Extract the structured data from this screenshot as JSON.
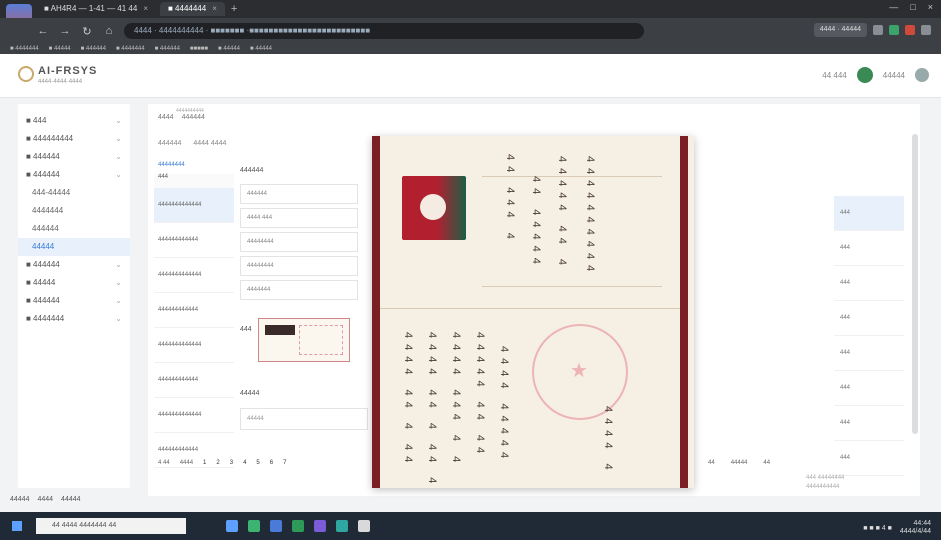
{
  "browser": {
    "tabs": [
      {
        "label": "■ AH4R4 — 1-41 — 41 44"
      },
      {
        "label": "■ 4444444"
      }
    ],
    "url": "4444 · 4444444444 · ■■■■■■■ ·■■■■■■■■■■■■■■■■■■■■■■■■■",
    "bookmarks": [
      "■ 4444444",
      "■ 44444",
      "■ 444444",
      "■ 4444444",
      "■ 444444",
      "■■■■■",
      "■ 44444",
      "■ 44444"
    ],
    "extension_chip": "4444 · 44444"
  },
  "header": {
    "logo": "AI-FRSYS",
    "logo_sub": "4444·4444·4444",
    "right_text": "44 444",
    "user": "44444"
  },
  "sidebar": {
    "items": [
      {
        "label": "■ 444",
        "active": false,
        "sub": false
      },
      {
        "label": "■ 444444444",
        "active": false,
        "sub": false
      },
      {
        "label": "■ 444444",
        "active": false,
        "sub": false
      },
      {
        "label": "■ 444444",
        "active": false,
        "sub": false
      },
      {
        "label": "444-44444",
        "active": false,
        "sub": true
      },
      {
        "label": "4444444",
        "active": false,
        "sub": true
      },
      {
        "label": "444444",
        "active": false,
        "sub": true
      },
      {
        "label": "44444",
        "active": true,
        "sub": true
      },
      {
        "label": "■ 444444",
        "active": false,
        "sub": false
      },
      {
        "label": "■ 44444",
        "active": false,
        "sub": false
      },
      {
        "label": "■ 444444",
        "active": false,
        "sub": false
      },
      {
        "label": "■ 4444444",
        "active": false,
        "sub": false
      }
    ],
    "status": [
      "44444",
      "4444",
      "44444"
    ]
  },
  "main": {
    "breadcrumb": [
      "4444",
      "444444"
    ],
    "breadcrumb_tag": "4444444444",
    "filters": [
      "444444",
      "4444 4444"
    ],
    "list": {
      "header": "44444444",
      "subheader": "444",
      "rows": [
        "4444444444444",
        "444444444444",
        "4444444444444",
        "444444444444",
        "4444444444444",
        "444444444444",
        "4444444444444",
        "444444444444"
      ]
    },
    "detail": {
      "title": "444444",
      "fields": [
        "444444",
        "4444 444",
        "44444444",
        "44444444",
        "4444444"
      ],
      "photo_label": "444",
      "remark_label": "44444",
      "remark_value": "44444"
    },
    "right_values": [
      "444",
      "444",
      "444",
      "444",
      "444",
      "444",
      "444",
      "444"
    ],
    "pager": {
      "left": [
        "4 44",
        "4444"
      ],
      "pages": [
        "1",
        "2",
        "3",
        "4",
        "5",
        "6",
        "7"
      ],
      "right": [
        "44",
        "44444",
        "44"
      ]
    },
    "watermark": [
      "444 44444444",
      "4444444444"
    ]
  },
  "viewer": {
    "upper_lines": [
      "44 444 4",
      "44 44444",
      "44444 44 4",
      "4444444444"
    ],
    "lower_lines": [
      "4444 44 4 44",
      "4444 44 4 44 4",
      "4444 444 4 4",
      "44444 44 44",
      "4444 44444",
      "4444 4"
    ]
  },
  "taskbar": {
    "search": "44 4444 4444444 44",
    "time": "44:44",
    "date": "4444/4/44",
    "tray": "■ ■ ■ 4 ■"
  }
}
